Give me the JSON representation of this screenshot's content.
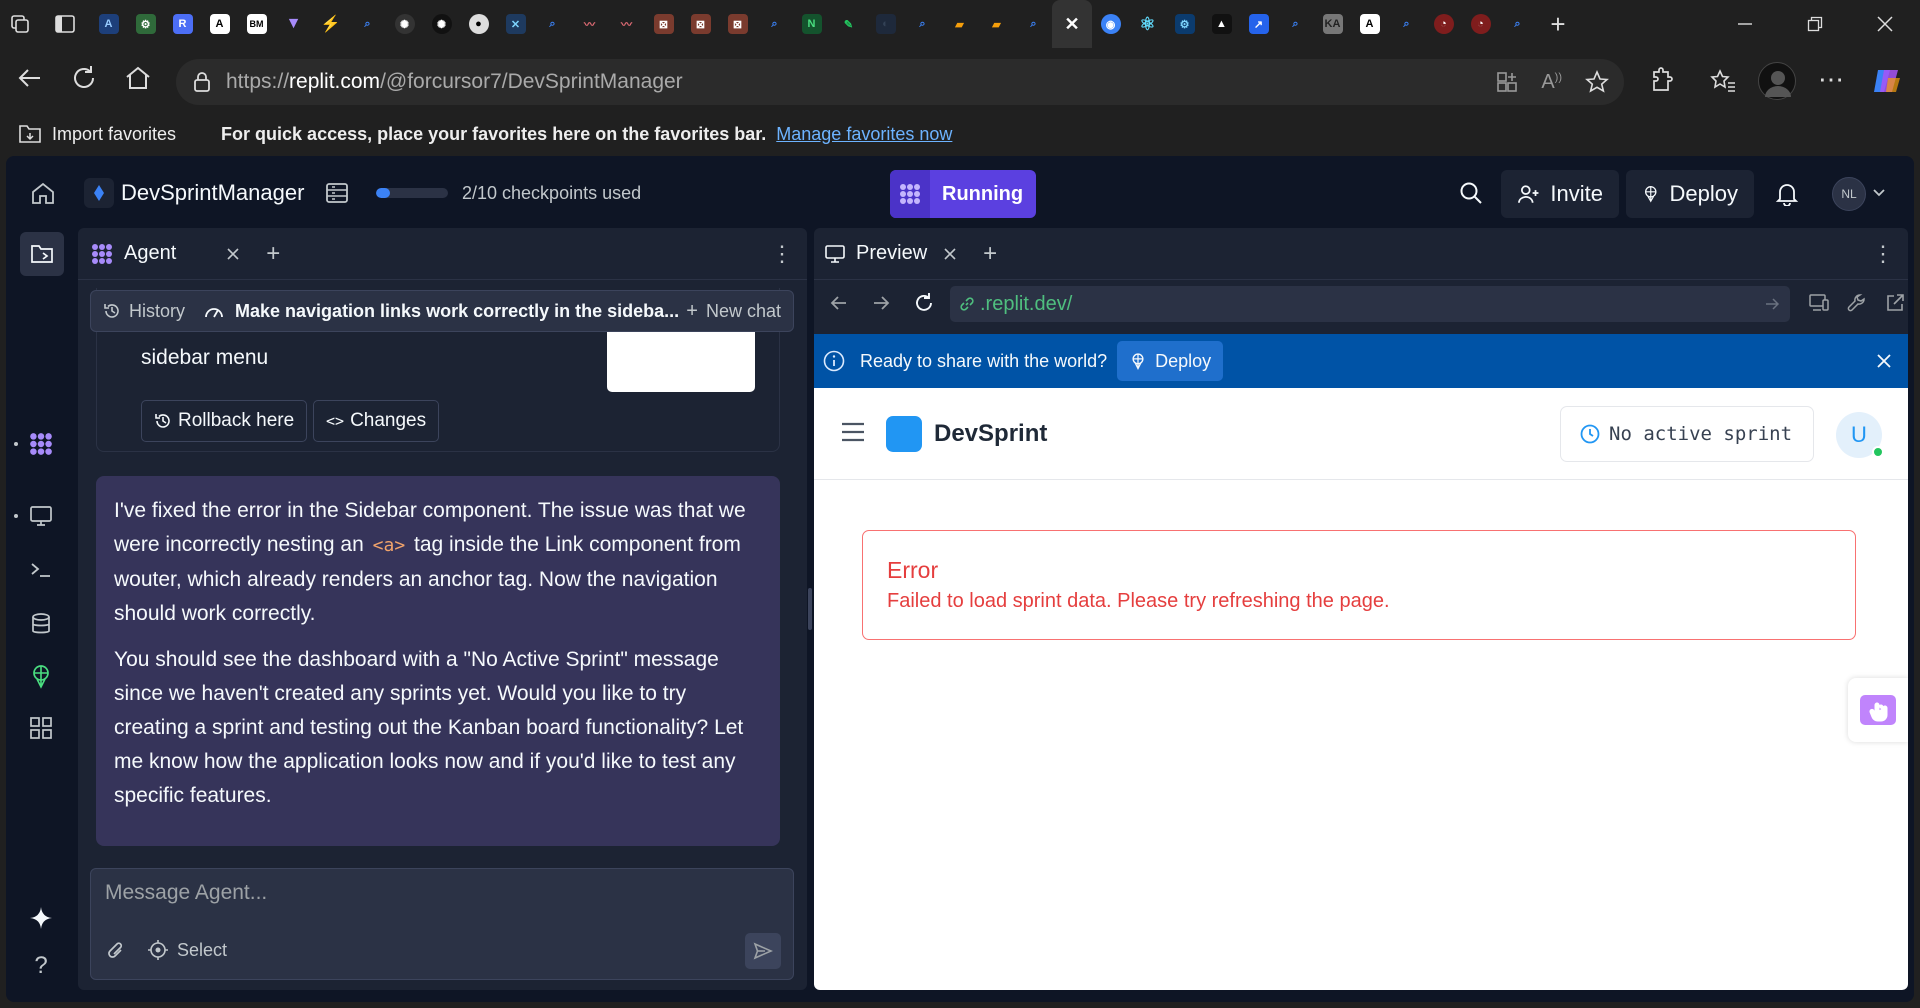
{
  "browser": {
    "url_prefix": "https://",
    "url_host": "replit.com",
    "url_path": "/@forcursor7/DevSprintManager",
    "import_favorites": "Import favorites",
    "fav_hint": "For quick access, place your favorites here on the favorites bar.",
    "manage_favorites": "Manage favorites now",
    "tab_badges": {
      "r": "R",
      "bm": "BM"
    }
  },
  "topbar": {
    "project_name": "DevSprintManager",
    "checkpoints": "2/10 checkpoints used",
    "checkpoint_fraction": 0.2,
    "run_label": "Running",
    "invite_label": "Invite",
    "deploy_label": "Deploy",
    "avatar_initials": "NL"
  },
  "agent": {
    "tab_label": "Agent",
    "history_label": "History",
    "chat_title": "Make navigation links work correctly in the sideba...",
    "new_chat_label": "New chat",
    "prev_msg_tail": "sidebar menu",
    "rollback_label": "Rollback here",
    "changes_label": "Changes",
    "message_p1_a": "I've fixed the error in the Sidebar component. The issue was that we were incorrectly nesting an",
    "message_code": "<a>",
    "message_p1_b": "tag inside the Link component from wouter, which already renders an anchor tag. Now the navigation should work correctly.",
    "message_p2": "You should see the dashboard with a \"No Active Sprint\" message since we haven't created any sprints yet. Would you like to try creating a sprint and testing out the Kanban board functionality? Let me know how the application looks now and if you'd like to test any specific features.",
    "input_placeholder": "Message Agent...",
    "select_label": "Select"
  },
  "preview": {
    "tab_label": "Preview",
    "url": ".replit.dev/",
    "banner_text": "Ready to share with the world?",
    "banner_deploy": "Deploy",
    "app_name": "DevSprint",
    "sprint_status": "No active sprint",
    "user_initial": "U",
    "error_title": "Error",
    "error_message": "Failed to load sprint data. Please try refreshing the page."
  },
  "colors": {
    "accent_purple": "#5b40e0",
    "replit_bg": "#0e1525",
    "panel_bg": "#1c2333",
    "message_bg": "#36345a",
    "banner_blue": "#0053a6",
    "error_red": "#e53e3e",
    "devsprint_blue": "#2196f3",
    "url_green": "#4fbf7f"
  }
}
